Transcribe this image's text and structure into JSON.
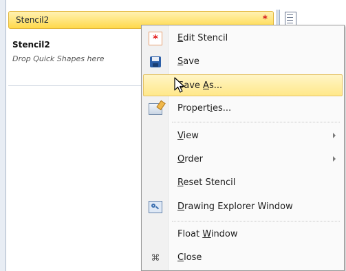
{
  "stencil": {
    "tab_label": "Stencil2",
    "tab_marker": "*",
    "title": "Stencil2",
    "hint": "Drop Quick Shapes here"
  },
  "menu": {
    "items": [
      {
        "label": "Edit Stencil",
        "mnemonic": "E",
        "icon": "edit-stencil-icon",
        "highlighted": false,
        "submenu": false
      },
      {
        "label": "Save",
        "mnemonic": "S",
        "icon": "save-icon",
        "highlighted": false,
        "submenu": false
      },
      {
        "label": "Save As...",
        "mnemonic": "A",
        "icon": "",
        "highlighted": true,
        "submenu": false
      },
      {
        "label": "Properties...",
        "mnemonic": "i",
        "icon": "properties-icon",
        "highlighted": false,
        "submenu": false
      },
      {
        "label": "View",
        "mnemonic": "V",
        "icon": "",
        "highlighted": false,
        "submenu": true
      },
      {
        "label": "Order",
        "mnemonic": "O",
        "icon": "",
        "highlighted": false,
        "submenu": true
      },
      {
        "label": "Reset Stencil",
        "mnemonic": "R",
        "icon": "",
        "highlighted": false,
        "submenu": false
      },
      {
        "label": "Drawing Explorer Window",
        "mnemonic": "D",
        "icon": "drawing-explorer-icon",
        "highlighted": false,
        "submenu": false
      },
      {
        "label": "Float Window",
        "mnemonic": "W",
        "icon": "",
        "highlighted": false,
        "submenu": false
      },
      {
        "label": "Close",
        "mnemonic": "C",
        "icon": "close-icon",
        "highlighted": false,
        "submenu": false
      }
    ]
  },
  "colors": {
    "tab_gradient_top": "#fff2b4",
    "tab_gradient_bottom": "#ffd94a",
    "highlight": "#ffe88a",
    "marker": "#d62222"
  }
}
